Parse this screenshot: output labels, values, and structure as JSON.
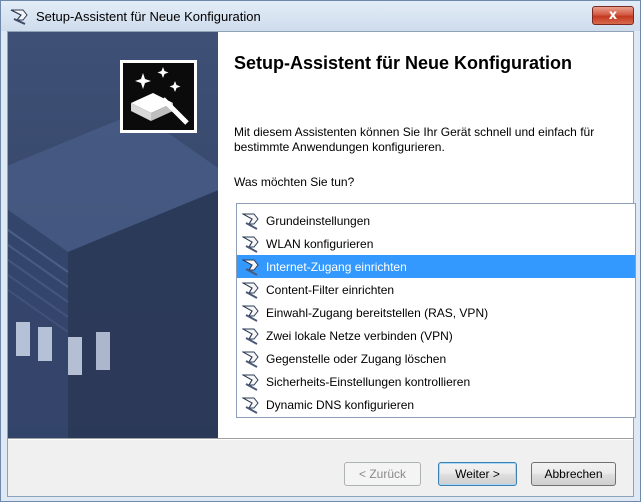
{
  "window": {
    "title": "Setup-Assistent für Neue Konfiguration",
    "close_label": "x"
  },
  "content": {
    "heading": "Setup-Assistent für Neue Konfiguration",
    "description": "Mit diesem Assistenten können Sie Ihr Gerät schnell und einfach für bestimmte Anwendungen konfigurieren.",
    "question": "Was möchten Sie tun?"
  },
  "options": {
    "selected_index": 2,
    "items": [
      {
        "label": "Grundeinstellungen"
      },
      {
        "label": "WLAN konfigurieren"
      },
      {
        "label": "Internet-Zugang einrichten"
      },
      {
        "label": "Content-Filter einrichten"
      },
      {
        "label": "Einwahl-Zugang bereitstellen (RAS, VPN)"
      },
      {
        "label": "Zwei lokale Netze verbinden (VPN)"
      },
      {
        "label": "Gegenstelle oder Zugang löschen"
      },
      {
        "label": "Sicherheits-Einstellungen kontrollieren"
      },
      {
        "label": "Dynamic DNS konfigurieren"
      }
    ],
    "item_icon": "wizard-wand-icon"
  },
  "buttons": {
    "back_label": "< Zurück",
    "next_label": "Weiter >",
    "cancel_label": "Abbrechen"
  },
  "colors": {
    "selection": "#3399ff",
    "side_panel": "#3a4b70",
    "close_button": "#c9462c"
  }
}
